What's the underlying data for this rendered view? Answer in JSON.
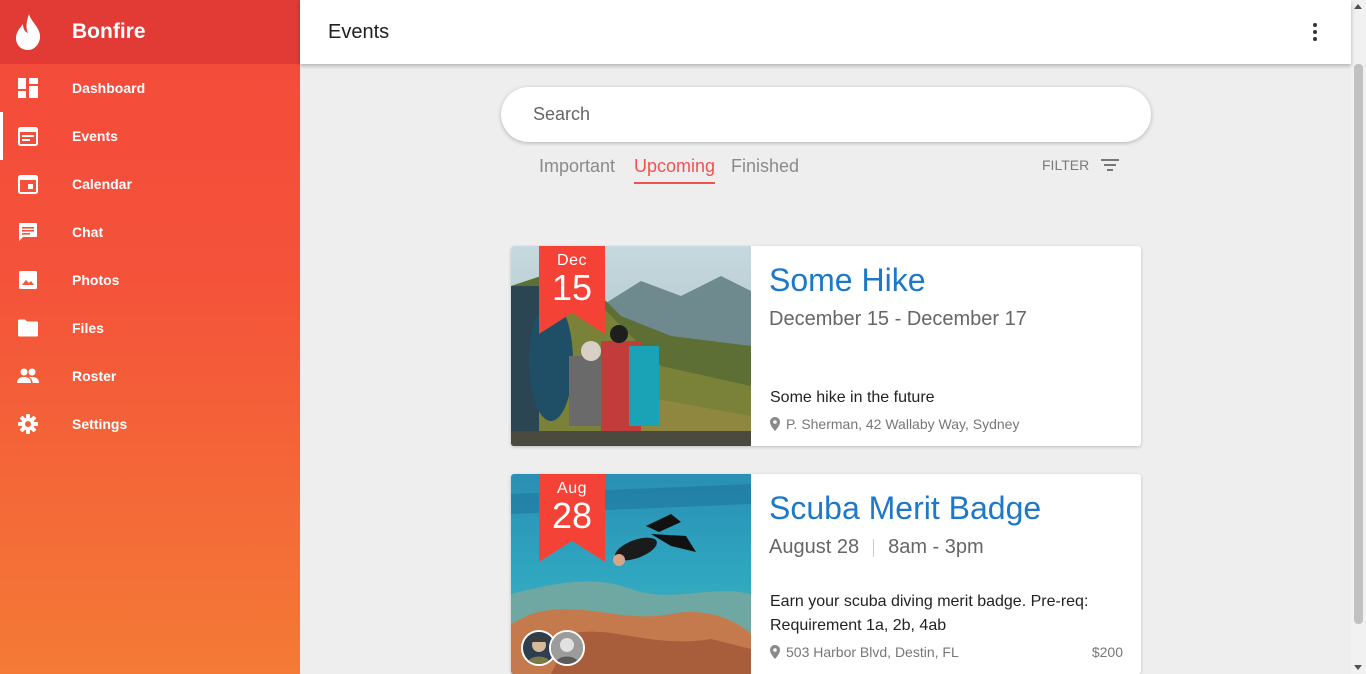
{
  "app": {
    "name": "Bonfire",
    "logo_icon": "flame-icon"
  },
  "sidebar": {
    "items": [
      {
        "label": "Dashboard",
        "icon": "dashboard-icon",
        "active": false
      },
      {
        "label": "Events",
        "icon": "event-note-icon",
        "active": true
      },
      {
        "label": "Calendar",
        "icon": "calendar-icon",
        "active": false
      },
      {
        "label": "Chat",
        "icon": "chat-icon",
        "active": false
      },
      {
        "label": "Photos",
        "icon": "image-icon",
        "active": false
      },
      {
        "label": "Files",
        "icon": "folder-icon",
        "active": false
      },
      {
        "label": "Roster",
        "icon": "people-icon",
        "active": false
      },
      {
        "label": "Settings",
        "icon": "gear-icon",
        "active": false
      }
    ]
  },
  "header": {
    "title": "Events",
    "menu_icon": "more-vert-icon"
  },
  "search": {
    "placeholder": "Search",
    "value": ""
  },
  "tabs": [
    {
      "label": "Important",
      "active": false
    },
    {
      "label": "Upcoming",
      "active": true
    },
    {
      "label": "Finished",
      "active": false
    }
  ],
  "filter": {
    "label": "FILTER",
    "icon": "filter-list-icon"
  },
  "events": [
    {
      "month": "Dec",
      "day": "15",
      "title": "Some Hike",
      "date": "December 15 - December 17",
      "time": "",
      "description": "Some hike in the future",
      "location": "P. Sherman, 42 Wallaby Way, Sydney",
      "price": ""
    },
    {
      "month": "Aug",
      "day": "28",
      "title": "Scuba Merit Badge",
      "date": "August 28",
      "time": "8am - 3pm",
      "description": "Earn your scuba diving merit badge. Pre-req: Requirement 1a, 2b, 4ab",
      "location": "503 Harbor Blvd, Destin, FL",
      "price": "$200"
    }
  ],
  "colors": {
    "accent": "#ef5350",
    "brand_bar": "#e23a35",
    "link_blue": "#1e78c8"
  }
}
